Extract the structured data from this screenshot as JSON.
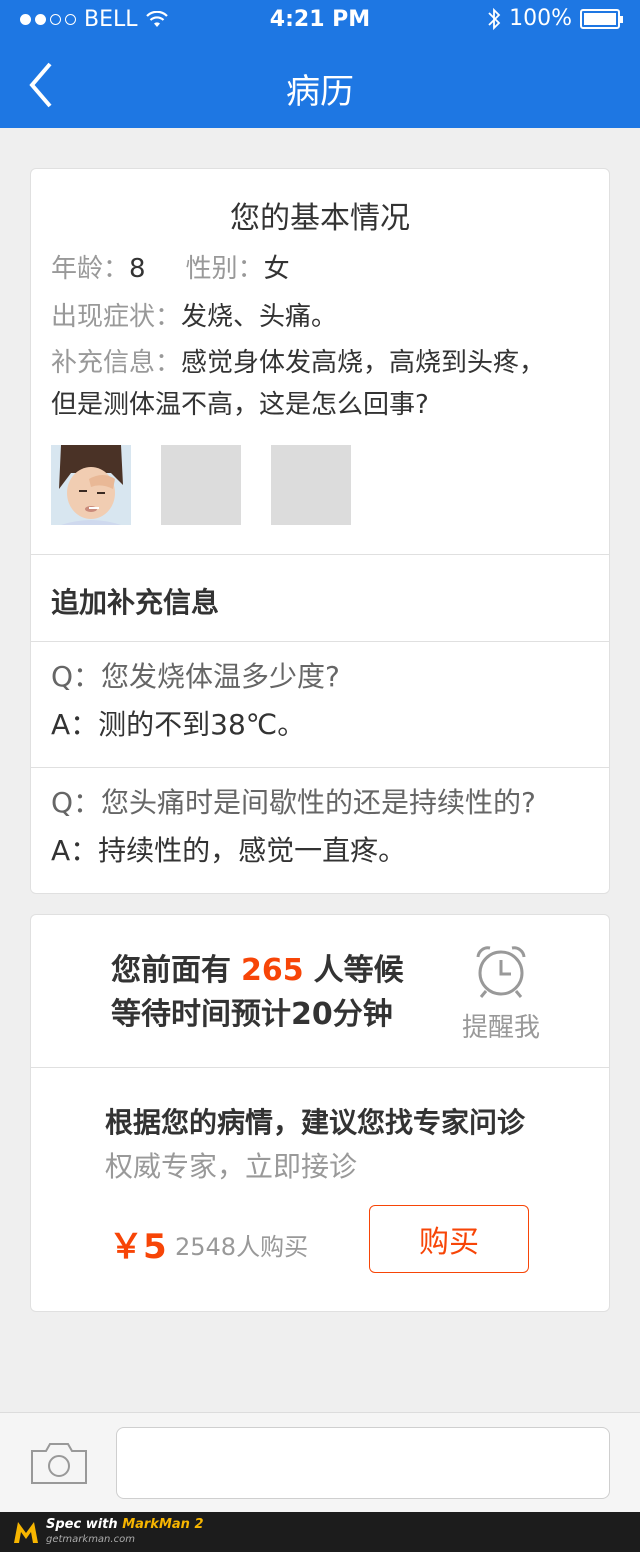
{
  "status_bar": {
    "carrier": "BELL",
    "time": "4:21 PM",
    "battery": "100%",
    "signal_filled_dots": 2,
    "signal_total_dots": 5
  },
  "nav": {
    "title": "病历",
    "back_icon": "chevron-left-icon"
  },
  "basic_info": {
    "title": "您的基本情况",
    "age_label": "年龄：",
    "age_value": "8",
    "gender_label": "性别：",
    "gender_value": "女",
    "symptom_label": "出现症状：",
    "symptom_value": "发烧、头痛。",
    "extra_label": "补充信息：",
    "extra_value_line1": "感觉身体发高烧，高烧到头疼，",
    "extra_value_line2": "但是测体温不高，这是怎么回事?"
  },
  "add_info": {
    "label": "追加补充信息"
  },
  "qa": [
    {
      "q_prefix": "Q：",
      "question": "您发烧体温多少度?",
      "a_prefix": "A：",
      "answer": "测的不到38℃。"
    },
    {
      "q_prefix": "Q：",
      "question": "您头痛时是间歇性的还是持续性的?",
      "a_prefix": "A：",
      "answer": "持续性的，感觉一直疼。"
    }
  ],
  "queue": {
    "before": "您前面有",
    "count": "265",
    "after": "人等候",
    "wait_line": "等待时间预计20分钟",
    "remind_label": "提醒我",
    "remind_icon": "alarm-clock-icon"
  },
  "recommendation": {
    "title": "根据您的病情，建议您找专家问诊",
    "subtitle": "权威专家，立即接诊",
    "price": "￥5",
    "buyers": "2548人购买",
    "buy_label": "购买"
  },
  "bottom_bar": {
    "camera_icon": "camera-icon",
    "input_value": ""
  },
  "footer": {
    "spec_prefix": "Spec with ",
    "spec_brand": "MarkMan 2",
    "url": "getmarkman.com"
  },
  "colors": {
    "header": "#1e77e3",
    "accent": "#f74507",
    "text_main": "#333333",
    "text_sub": "#999999",
    "divider": "#e0e0e0"
  }
}
